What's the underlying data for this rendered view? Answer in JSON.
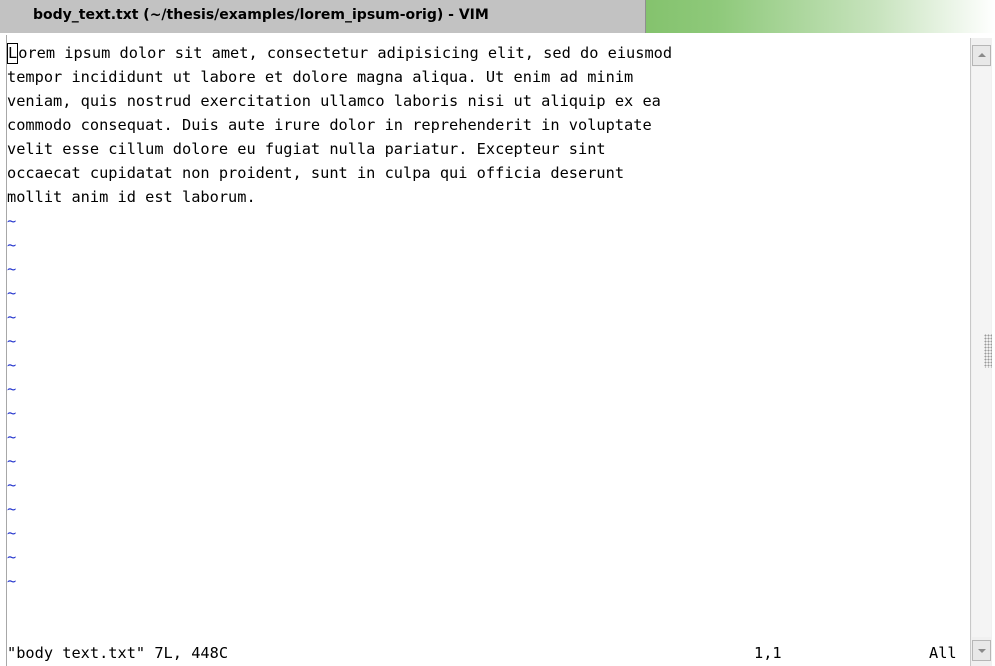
{
  "window": {
    "title": "body_text.txt (~/thesis/examples/lorem_ipsum-orig) - VIM"
  },
  "buffer": {
    "cursor_char": "L",
    "first_line_rest": "orem ipsum dolor sit amet, consectetur adipisicing elit, sed do eiusmod",
    "lines": [
      "tempor incididunt ut labore et dolore magna aliqua. Ut enim ad minim",
      "veniam, quis nostrud exercitation ullamco laboris nisi ut aliquip ex ea",
      "commodo consequat. Duis aute irure dolor in reprehenderit in voluptate",
      "velit esse cillum dolore eu fugiat nulla pariatur. Excepteur sint",
      "occaecat cupidatat non proident, sunt in culpa qui officia deserunt",
      "mollit anim id est laborum."
    ],
    "empty_line_marker": "~",
    "empty_line_count": 16
  },
  "statusline": {
    "file_info": "\"body_text.txt\" 7L, 448C",
    "cursor_position": "1,1",
    "scroll_position": "All"
  },
  "colors": {
    "tilde": "#2233cc",
    "title_tab": "#c2c2c2",
    "title_bar_accent": "#5aa23a"
  },
  "icons": {
    "scroll_up": "chevron-up-icon",
    "scroll_down": "chevron-down-icon",
    "scroll_grip": "grip-icon"
  }
}
